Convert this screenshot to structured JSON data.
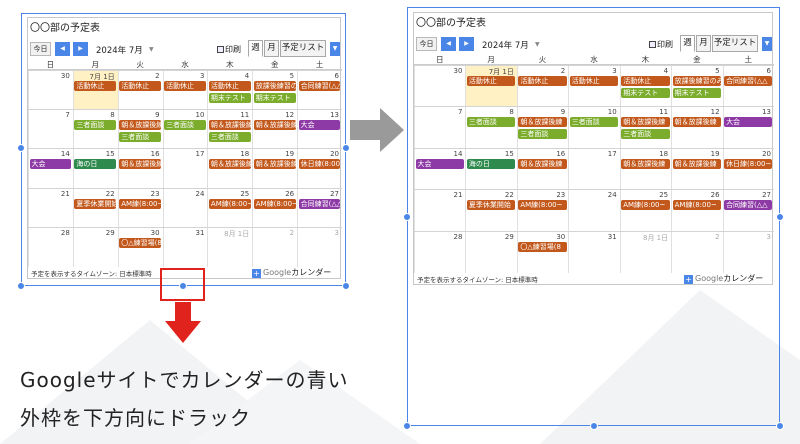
{
  "calendar": {
    "title": "〇〇部の予定表",
    "today_label": "今日",
    "month_label": "2024年 7月",
    "print_label": "印刷",
    "tabs": [
      {
        "label": "週",
        "active": true
      },
      {
        "label": "月",
        "active": false
      },
      {
        "label": "予定リスト",
        "active": false
      }
    ],
    "weekdays": [
      "日",
      "月",
      "火",
      "水",
      "木",
      "金",
      "土"
    ],
    "weeks": [
      {
        "days": [
          {
            "label": "30",
            "muted": false
          },
          {
            "label": "7月 1日",
            "muted": false,
            "today": true
          },
          {
            "label": "2",
            "muted": false
          },
          {
            "label": "3",
            "muted": false
          },
          {
            "label": "4",
            "muted": false
          },
          {
            "label": "5",
            "muted": false
          },
          {
            "label": "6",
            "muted": false
          }
        ],
        "events": [
          {
            "col": 1,
            "row": 0,
            "span": 1,
            "text": "活動休止",
            "color": "orange"
          },
          {
            "col": 2,
            "row": 0,
            "span": 1,
            "text": "活動休止",
            "color": "orange"
          },
          {
            "col": 3,
            "row": 0,
            "span": 1,
            "text": "活動休止",
            "color": "orange"
          },
          {
            "col": 4,
            "row": 0,
            "span": 1,
            "text": "活動休止",
            "color": "orange"
          },
          {
            "col": 5,
            "row": 0,
            "span": 1,
            "text": "放課後練習のみ",
            "color": "orange"
          },
          {
            "col": 6,
            "row": 0,
            "span": 1,
            "text": "合同練習(△△",
            "color": "orange"
          },
          {
            "col": 4,
            "row": 1,
            "span": 1,
            "text": "期末テスト",
            "color": "green"
          },
          {
            "col": 5,
            "row": 1,
            "span": 1,
            "text": "期末テスト",
            "color": "green"
          }
        ]
      },
      {
        "days": [
          {
            "label": "7",
            "muted": false
          },
          {
            "label": "8",
            "muted": false
          },
          {
            "label": "9",
            "muted": false
          },
          {
            "label": "10",
            "muted": false
          },
          {
            "label": "11",
            "muted": false
          },
          {
            "label": "12",
            "muted": false
          },
          {
            "label": "13",
            "muted": false
          }
        ],
        "events": [
          {
            "col": 1,
            "row": 0,
            "span": 1,
            "text": "三者面談",
            "color": "green"
          },
          {
            "col": 2,
            "row": 0,
            "span": 1,
            "text": "朝＆放課後練",
            "color": "orange"
          },
          {
            "col": 3,
            "row": 0,
            "span": 1,
            "text": "三者面談",
            "color": "green"
          },
          {
            "col": 4,
            "row": 0,
            "span": 1,
            "text": "朝＆放課後練",
            "color": "orange"
          },
          {
            "col": 5,
            "row": 0,
            "span": 1,
            "text": "朝＆放課後練",
            "color": "orange"
          },
          {
            "col": 6,
            "row": 0,
            "span": 1,
            "text": "大会",
            "color": "purple"
          },
          {
            "col": 2,
            "row": 1,
            "span": 1,
            "text": "三者面談",
            "color": "green"
          },
          {
            "col": 4,
            "row": 1,
            "span": 1,
            "text": "三者面談",
            "color": "green"
          }
        ]
      },
      {
        "days": [
          {
            "label": "14",
            "muted": false
          },
          {
            "label": "15",
            "muted": false
          },
          {
            "label": "16",
            "muted": false
          },
          {
            "label": "17",
            "muted": false
          },
          {
            "label": "18",
            "muted": false
          },
          {
            "label": "19",
            "muted": false
          },
          {
            "label": "20",
            "muted": false
          }
        ],
        "events": [
          {
            "col": 0,
            "row": 0,
            "span": 1,
            "text": "大会",
            "color": "purple"
          },
          {
            "col": 1,
            "row": 0,
            "span": 1,
            "text": "海の日",
            "color": "teal"
          },
          {
            "col": 2,
            "row": 0,
            "span": 1,
            "text": "朝＆放課後練",
            "color": "orange"
          },
          {
            "col": 4,
            "row": 0,
            "span": 1,
            "text": "朝＆放課後練",
            "color": "orange"
          },
          {
            "col": 5,
            "row": 0,
            "span": 1,
            "text": "朝＆放課後練",
            "color": "orange"
          },
          {
            "col": 6,
            "row": 0,
            "span": 1,
            "text": "休日練(8:00~",
            "color": "orange"
          }
        ]
      },
      {
        "days": [
          {
            "label": "21",
            "muted": false
          },
          {
            "label": "22",
            "muted": false
          },
          {
            "label": "23",
            "muted": false
          },
          {
            "label": "24",
            "muted": false
          },
          {
            "label": "25",
            "muted": false
          },
          {
            "label": "26",
            "muted": false
          },
          {
            "label": "27",
            "muted": false
          }
        ],
        "events": [
          {
            "col": 1,
            "row": 0,
            "span": 1,
            "text": "夏季休業開始",
            "color": "orange"
          },
          {
            "col": 2,
            "row": 0,
            "span": 1,
            "text": "AM練(8:00~",
            "color": "orange"
          },
          {
            "col": 4,
            "row": 0,
            "span": 1,
            "text": "AM練(8:00~",
            "color": "orange"
          },
          {
            "col": 5,
            "row": 0,
            "span": 1,
            "text": "AM練(8:00~",
            "color": "orange"
          },
          {
            "col": 6,
            "row": 0,
            "span": 1,
            "text": "合同練習(△△",
            "color": "purple"
          }
        ]
      },
      {
        "days": [
          {
            "label": "28",
            "muted": false
          },
          {
            "label": "29",
            "muted": false
          },
          {
            "label": "30",
            "muted": false
          },
          {
            "label": "31",
            "muted": false
          },
          {
            "label": "8月 1日",
            "muted": true
          },
          {
            "label": "2",
            "muted": true
          },
          {
            "label": "3",
            "muted": true
          }
        ],
        "events": [
          {
            "col": 2,
            "row": 0,
            "span": 1,
            "text": "〇△練習場(8",
            "color": "orange"
          }
        ]
      }
    ],
    "footer_timezone": "予定を表示するタイムゾーン: 日本標準時",
    "google_brand": "Google",
    "google_suffix": "カレンダー"
  },
  "instruction": {
    "line1": "Googleサイトでカレンダーの青い",
    "line2": "外枠を下方向にドラック"
  },
  "colors": {
    "orange": "#c2581c",
    "green": "#7bac2c",
    "purple": "#8e3aa6",
    "teal": "#2f8a4e",
    "accent": "#4a86e8",
    "highlight": "#e0231c",
    "arrow_gray": "#9a9a9a"
  }
}
